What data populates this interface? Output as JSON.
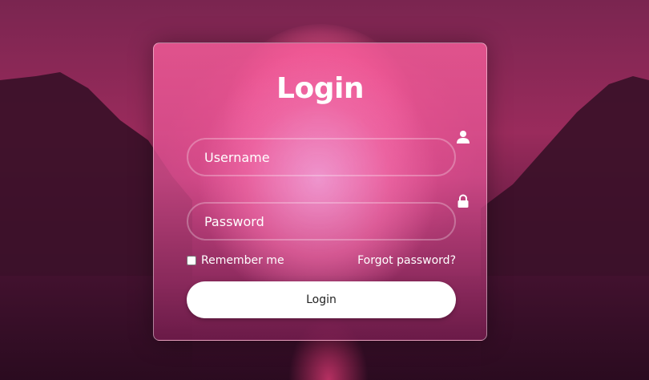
{
  "login_form": {
    "title": "Login",
    "username": {
      "placeholder": "Username",
      "icon": "user-icon"
    },
    "password": {
      "placeholder": "Password",
      "icon": "lock-icon"
    },
    "remember_label": "Remember me",
    "forgot_label": "Forgot password?",
    "submit_label": "Login"
  },
  "colors": {
    "card_tint": "#e85a95",
    "button_bg": "#ffffff",
    "button_text": "#222222",
    "text": "#ffffff"
  }
}
